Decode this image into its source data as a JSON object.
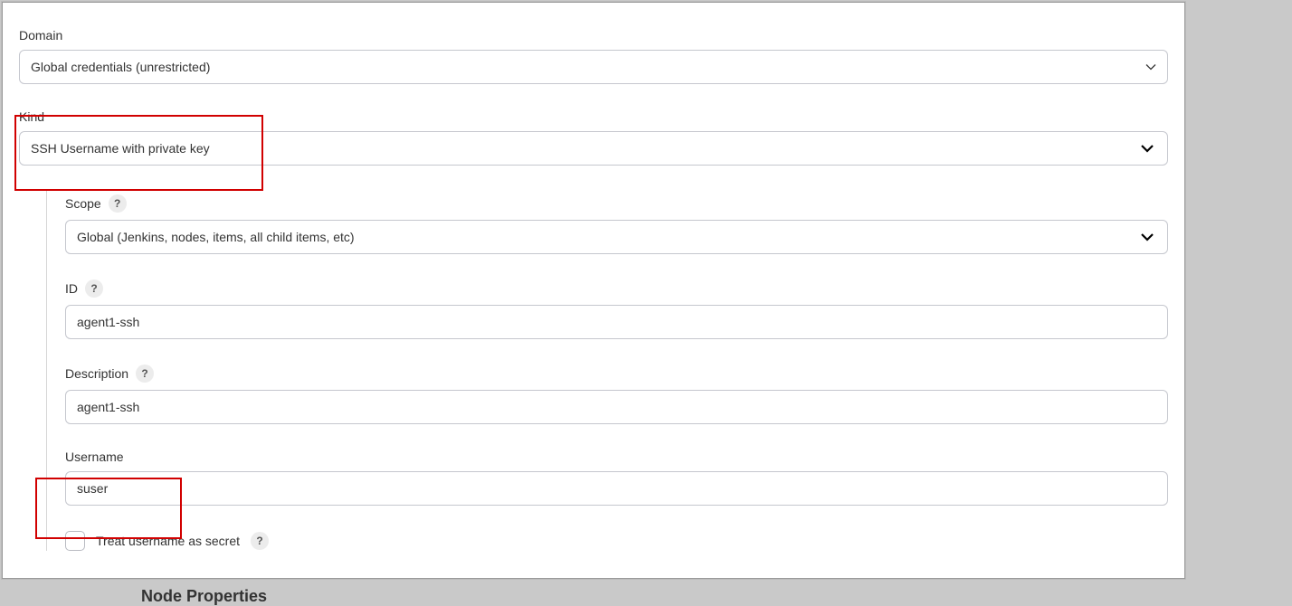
{
  "domain": {
    "label": "Domain",
    "value": "Global credentials (unrestricted)"
  },
  "kind": {
    "label": "Kind",
    "value": "SSH Username with private key"
  },
  "scope": {
    "label": "Scope",
    "value": "Global (Jenkins, nodes, items, all child items, etc)"
  },
  "id": {
    "label": "ID",
    "value": "agent1-ssh"
  },
  "description": {
    "label": "Description",
    "value": "agent1-ssh"
  },
  "username": {
    "label": "Username",
    "value": "suser"
  },
  "treatSecret": {
    "label": "Treat username as secret"
  },
  "help_char": "?",
  "overlay_heading": "Node Properties"
}
